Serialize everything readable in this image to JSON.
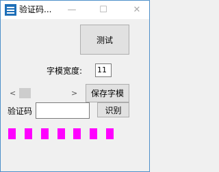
{
  "window": {
    "title": "验证码...",
    "minimize_glyph": "—",
    "maximize_glyph": "☐",
    "close_glyph": "✕"
  },
  "buttons": {
    "test": "测试",
    "save_glyph": "保存字模",
    "recognize": "识别"
  },
  "labels": {
    "glyph_width": "字模宽度:",
    "captcha": "验证码"
  },
  "inputs": {
    "glyph_width_value": "11",
    "captcha_value": ""
  },
  "scrollbar": {
    "left_arrow": "<",
    "right_arrow": ">"
  },
  "colors": {
    "dot_color": "#ff00ff",
    "accent": "#4d8fc9"
  },
  "dots": {
    "count": 7
  }
}
